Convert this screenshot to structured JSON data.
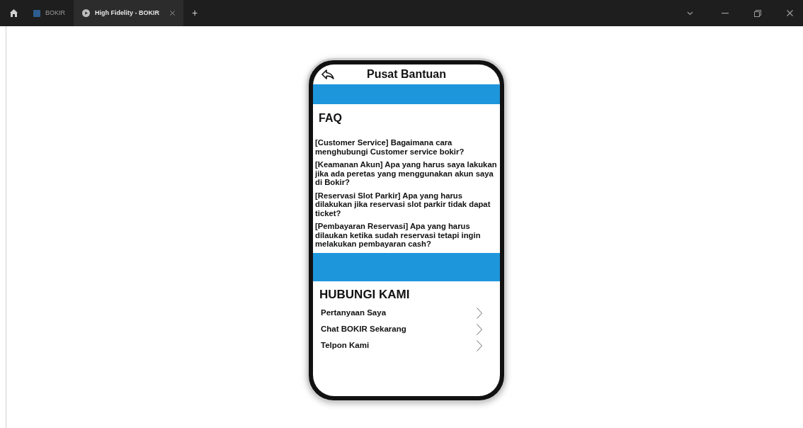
{
  "tabs": [
    {
      "label": "BOKIR",
      "kind": "file",
      "selected": false
    },
    {
      "label": "High Fidelity - BOKIR",
      "kind": "prototype",
      "selected": true
    }
  ],
  "new_tab": "+",
  "screen": {
    "title": "Pusat Bantuan",
    "faq_heading": "FAQ",
    "faq": [
      "[Customer Service] Bagaimana cara menghubungi Customer service bokir?",
      "[Keamanan Akun] Apa yang harus saya lakukan jika ada peretas yang menggunakan akun saya di Bokir?",
      "[Reservasi Slot Parkir] Apa yang harus dilakukan jika reservasi slot parkir tidak dapat ticket?",
      "[Pembayaran Reservasi] Apa yang harus dilaukan ketika sudah reservasi tetapi ingin melakukan pembayaran cash?"
    ],
    "contact_heading": "HUBUNGI KAMI",
    "contact": [
      "Pertanyaan Saya",
      "Chat BOKIR Sekarang",
      "Telpon Kami"
    ]
  }
}
